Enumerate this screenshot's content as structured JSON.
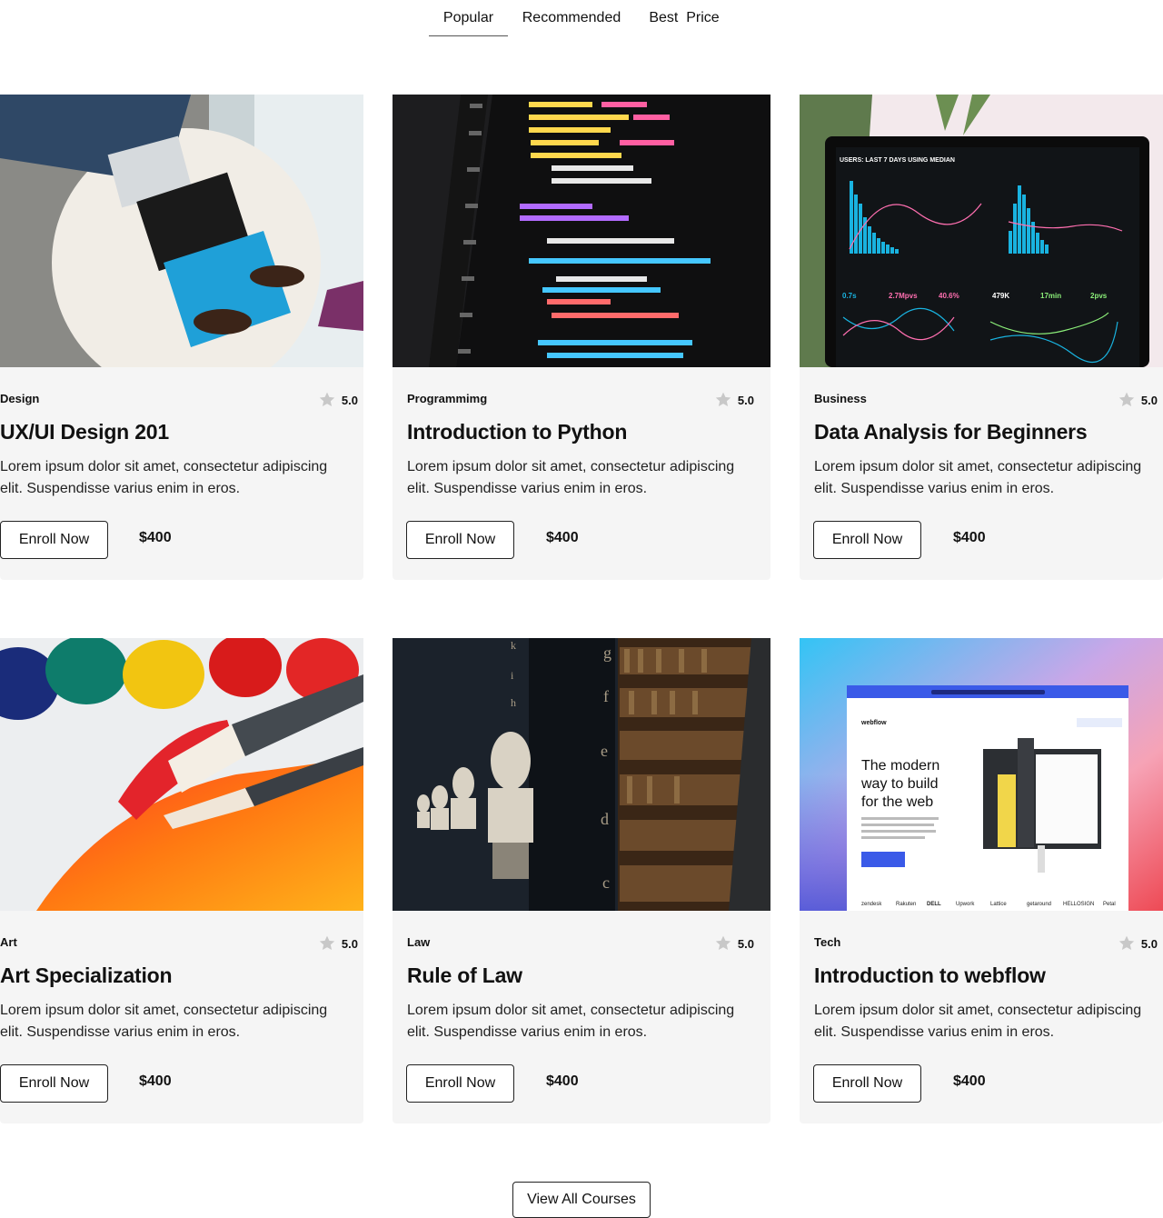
{
  "tabs": [
    {
      "label": "Popular",
      "active": true
    },
    {
      "label": "Recommended",
      "active": false
    },
    {
      "label": "Best  Price",
      "active": false
    }
  ],
  "courses": [
    {
      "category": "Design",
      "rating": "5.0",
      "title": "UX/UI Design 201",
      "description": "Lorem ipsum dolor sit amet, consectetur adipiscing elit. Suspendisse varius enim in eros.",
      "button": "Enroll Now",
      "price": "$400",
      "image": "laptop-photo"
    },
    {
      "category": "Programmimg",
      "rating": "5.0",
      "title": "Introduction to Python",
      "description": "Lorem ipsum dolor sit amet, consectetur adipiscing elit. Suspendisse varius enim in eros.",
      "button": "Enroll Now",
      "price": "$400",
      "image": "code-photo"
    },
    {
      "category": "Business",
      "rating": "5.0",
      "title": "Data Analysis for Beginners",
      "description": "Lorem ipsum dolor sit amet, consectetur adipiscing elit. Suspendisse varius enim in eros.",
      "button": "Enroll Now",
      "price": "$400",
      "image": "dashboard-photo"
    },
    {
      "category": "Art",
      "rating": "5.0",
      "title": "Art Specialization",
      "description": "Lorem ipsum dolor sit amet, consectetur adipiscing elit. Suspendisse varius enim in eros.",
      "button": "Enroll Now",
      "price": "$400",
      "image": "paint-photo"
    },
    {
      "category": "Law",
      "rating": "5.0",
      "title": "Rule of Law",
      "description": "Lorem ipsum dolor sit amet, consectetur adipiscing elit. Suspendisse varius enim in eros.",
      "button": "Enroll Now",
      "price": "$400",
      "image": "library-photo"
    },
    {
      "category": "Tech",
      "rating": "5.0",
      "title": "Introduction to webflow",
      "description": "Lorem ipsum dolor sit amet, consectetur adipiscing elit. Suspendisse varius enim in eros.",
      "button": "Enroll Now",
      "price": "$400",
      "image": "webflow-photo"
    }
  ],
  "image_text": {
    "dashboard_header": "USERS: LAST 7 DAYS USING MEDIAN",
    "dashboard_values": [
      "0.7s",
      "2.7Mpvs",
      "40.6%",
      "479K",
      "17min",
      "2pvs"
    ],
    "webflow_logo": "webflow",
    "webflow_headline": [
      "The modern",
      "way to build",
      "for the web"
    ],
    "webflow_clients": [
      "zendesk",
      "Rakuten",
      "DELL",
      "Upwork",
      "Lattice",
      "getaround",
      "HELLOSIGN",
      "Petal"
    ]
  },
  "view_all_label": "View All Courses",
  "colors": {
    "card_bg": "#f5f5f5",
    "star": "#c8c8c8",
    "border": "#222222"
  }
}
